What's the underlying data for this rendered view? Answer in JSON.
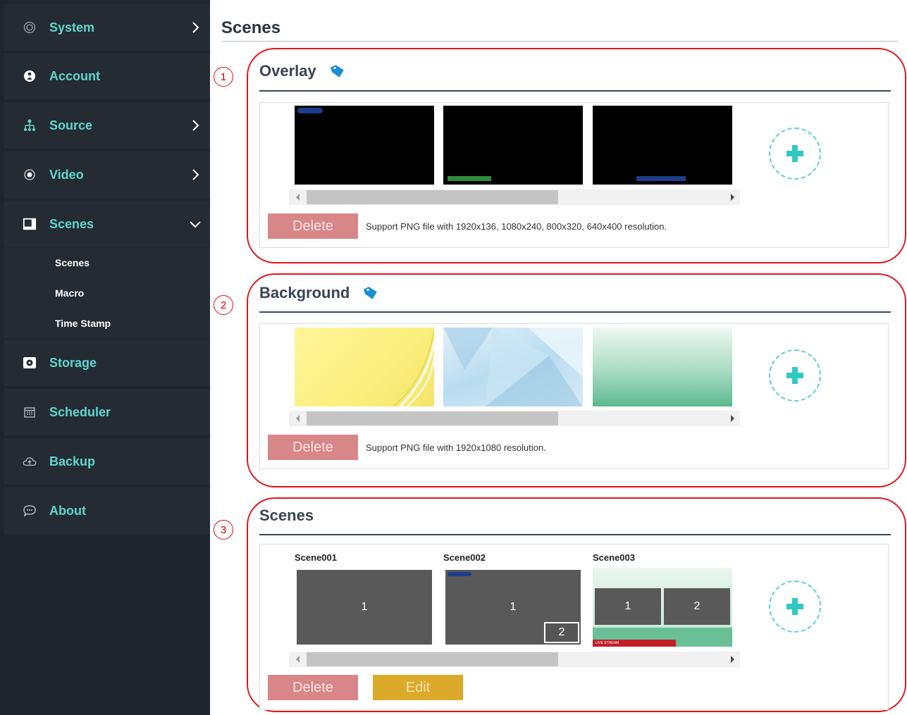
{
  "sidebar": {
    "items": [
      {
        "label": "System",
        "icon": "circle-target-icon",
        "has_chevron": "right"
      },
      {
        "label": "Account",
        "icon": "user-circle-icon"
      },
      {
        "label": "Source",
        "icon": "network-tree-icon",
        "has_chevron": "right"
      },
      {
        "label": "Video",
        "icon": "radio-dot-icon",
        "has_chevron": "right"
      },
      {
        "label": "Scenes",
        "icon": "scenes-square-icon",
        "has_chevron": "down"
      },
      {
        "label": "Storage",
        "icon": "hard-drive-icon"
      },
      {
        "label": "Scheduler",
        "icon": "calendar-icon"
      },
      {
        "label": "Backup",
        "icon": "cloud-upload-icon"
      },
      {
        "label": "About",
        "icon": "chat-dots-icon"
      }
    ],
    "scenes_subitems": [
      "Scenes",
      "Macro",
      "Time Stamp"
    ]
  },
  "page": {
    "title": "Scenes"
  },
  "overlay": {
    "marker": "1",
    "title": "Overlay",
    "delete_label": "Delete",
    "note": "Support PNG file with 1920x136, 1080x240, 800x320, 640x400 resolution."
  },
  "background": {
    "marker": "2",
    "title": "Background",
    "delete_label": "Delete",
    "note": "Support PNG file with 1920x1080 resolution."
  },
  "scenes": {
    "marker": "3",
    "title": "Scenes",
    "delete_label": "Delete",
    "edit_label": "Edit",
    "items": [
      {
        "name": "Scene001",
        "windows": [
          "1"
        ]
      },
      {
        "name": "Scene002",
        "windows": [
          "1",
          "2"
        ]
      },
      {
        "name": "Scene003",
        "windows": [
          "1",
          "2"
        ],
        "banner": "LIVE STREAM"
      }
    ]
  },
  "colors": {
    "sidebar_bg": "#1f252c",
    "nav_bg": "#242b33",
    "nav_accent": "#5fd6d0",
    "delete_btn": "#d88688",
    "edit_btn": "#dbaa2a",
    "annotation_red": "#e0161c",
    "add_dashed": "#58d1cc"
  }
}
